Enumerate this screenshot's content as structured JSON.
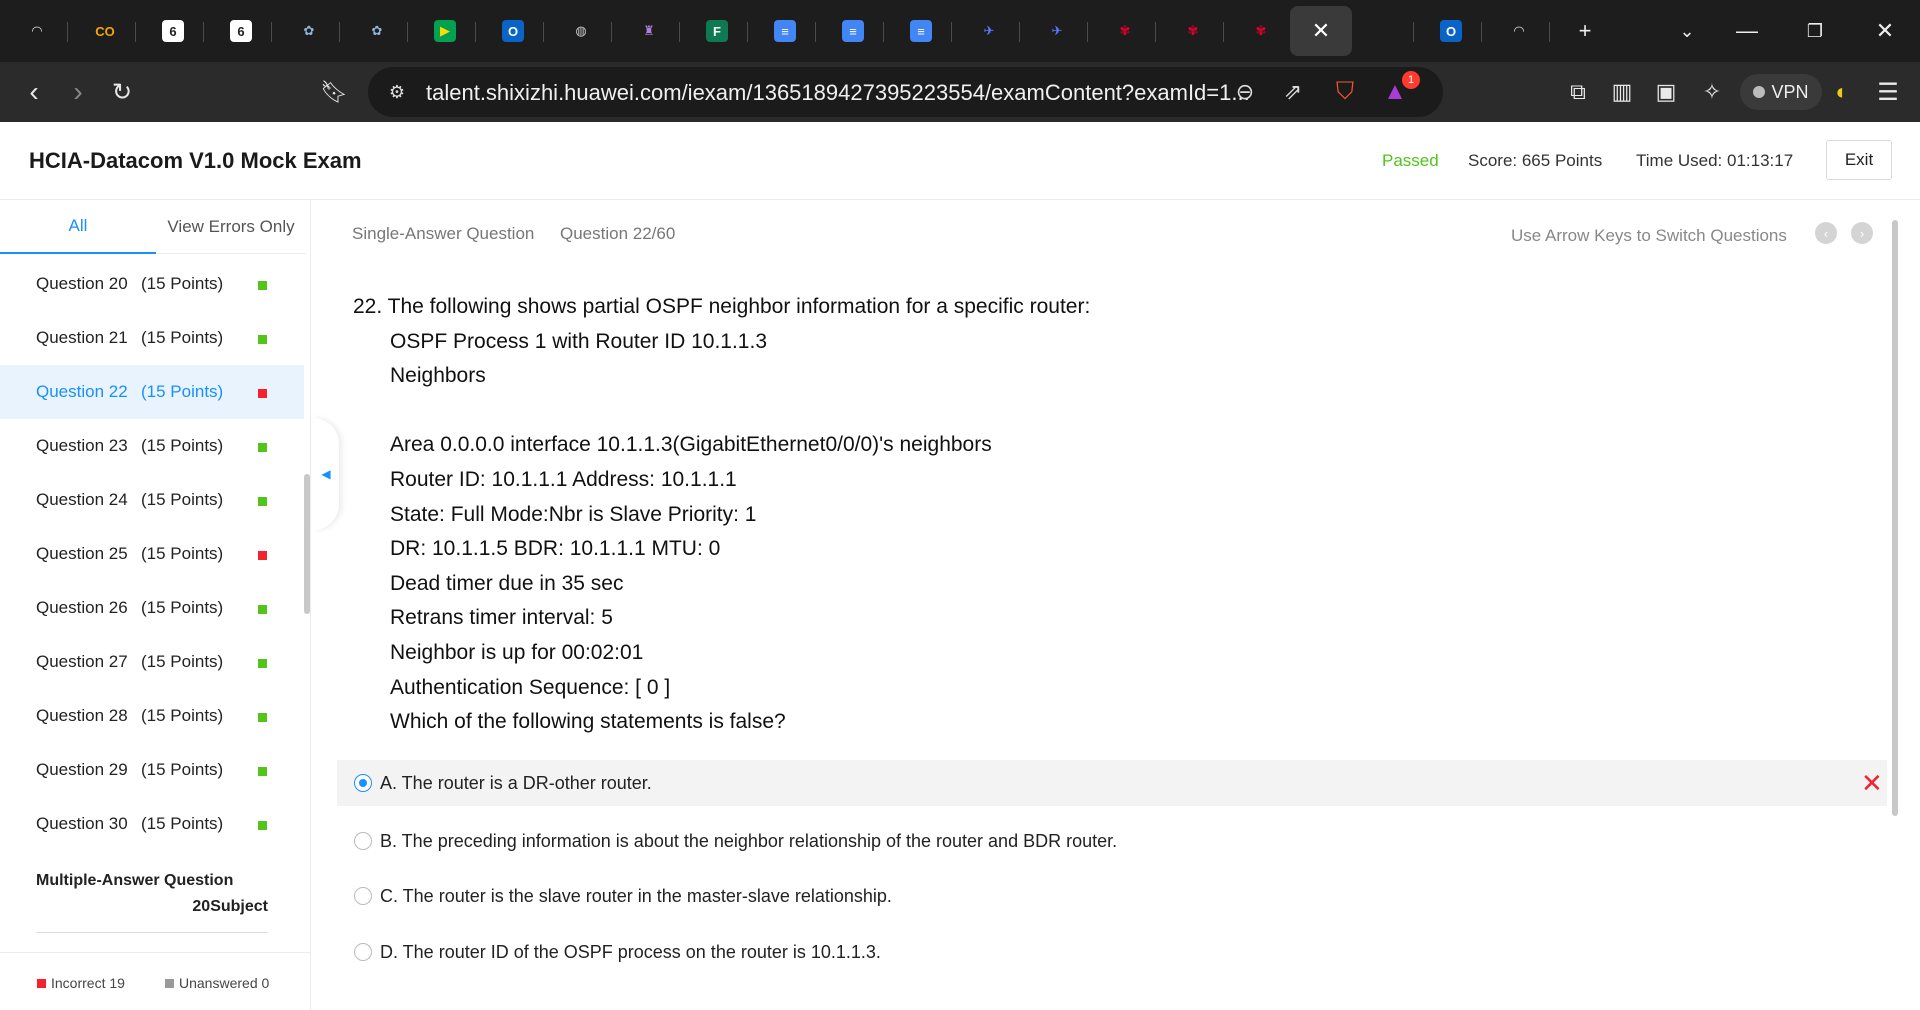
{
  "browser": {
    "tabs": [
      {
        "icon": "tab-icon-speedometer",
        "glyph": "◠",
        "bg": "#1d1d1d",
        "color": "#ddd"
      },
      {
        "icon": "tab-icon-co-logo",
        "glyph": "CO",
        "bg": "#1d1d1d",
        "color": "#f7a600"
      },
      {
        "icon": "tab-icon-six-logo",
        "glyph": "6",
        "bg": "#ffffff",
        "color": "#222"
      },
      {
        "icon": "tab-icon-six-logo",
        "glyph": "6",
        "bg": "#ffffff",
        "color": "#222"
      },
      {
        "icon": "tab-icon-emblem",
        "glyph": "✿",
        "bg": "#1d1d1d",
        "color": "#8fb3d9"
      },
      {
        "icon": "tab-icon-emblem",
        "glyph": "✿",
        "bg": "#1d1d1d",
        "color": "#8fb3d9"
      },
      {
        "icon": "tab-icon-meet",
        "glyph": "▶",
        "bg": "#00a150",
        "color": "#ffdd00"
      },
      {
        "icon": "tab-icon-outlook",
        "glyph": "O",
        "bg": "#0a64c8",
        "color": "#fff"
      },
      {
        "icon": "tab-icon-globe",
        "glyph": "◍",
        "bg": "#1d1d1d",
        "color": "#ccc"
      },
      {
        "icon": "tab-icon-building",
        "glyph": "♜",
        "bg": "#1d1d1d",
        "color": "#b07dd9"
      },
      {
        "icon": "tab-icon-forms",
        "glyph": "F",
        "bg": "#0e7a53",
        "color": "#fff"
      },
      {
        "icon": "tab-icon-docs",
        "glyph": "≡",
        "bg": "#4285f4",
        "color": "#fff"
      },
      {
        "icon": "tab-icon-docs",
        "glyph": "≡",
        "bg": "#4285f4",
        "color": "#fff"
      },
      {
        "icon": "tab-icon-docs",
        "glyph": "≡",
        "bg": "#4285f4",
        "color": "#fff"
      },
      {
        "icon": "tab-icon-bird",
        "glyph": "✈",
        "bg": "#1d1d1d",
        "color": "#5b7cff"
      },
      {
        "icon": "tab-icon-bird",
        "glyph": "✈",
        "bg": "#1d1d1d",
        "color": "#5b7cff"
      },
      {
        "icon": "tab-icon-huawei",
        "glyph": "✾",
        "bg": "#1d1d1d",
        "color": "#e4002b"
      },
      {
        "icon": "tab-icon-huawei",
        "glyph": "✾",
        "bg": "#1d1d1d",
        "color": "#e4002b"
      },
      {
        "icon": "tab-icon-huawei",
        "glyph": "✾",
        "bg": "#1d1d1d",
        "color": "#e4002b"
      }
    ],
    "active_tab_glyph": "✕",
    "url": "talent.shixizhi.huawei.com/iexam/1365189427395223554/examContent?examId=1...",
    "vpn_label": "VPN",
    "brave_badge": "1"
  },
  "header": {
    "title": "HCIA-Datacom V1.0 Mock Exam",
    "status": "Passed",
    "score": "Score:  665 Points",
    "time_used": "Time Used:  01:13:17",
    "exit_label": "Exit"
  },
  "sidebar": {
    "tab_all": "All",
    "tab_errors": "View Errors Only",
    "questions": [
      {
        "label": "Question 20",
        "points": "(15 Points)",
        "status": "correct"
      },
      {
        "label": "Question 21",
        "points": "(15 Points)",
        "status": "correct"
      },
      {
        "label": "Question 22",
        "points": "(15 Points)",
        "status": "incorrect"
      },
      {
        "label": "Question 23",
        "points": "(15 Points)",
        "status": "correct"
      },
      {
        "label": "Question 24",
        "points": "(15 Points)",
        "status": "correct"
      },
      {
        "label": "Question 25",
        "points": "(15 Points)",
        "status": "incorrect"
      },
      {
        "label": "Question 26",
        "points": "(15 Points)",
        "status": "correct"
      },
      {
        "label": "Question 27",
        "points": "(15 Points)",
        "status": "correct"
      },
      {
        "label": "Question 28",
        "points": "(15 Points)",
        "status": "correct"
      },
      {
        "label": "Question 29",
        "points": "(15 Points)",
        "status": "correct"
      },
      {
        "label": "Question 30",
        "points": "(15 Points)",
        "status": "correct"
      }
    ],
    "current_question": "Question 22",
    "multi_heading": "Multiple-Answer Question",
    "multi_sub": "20Subject",
    "legend_incorrect": "Incorrect 19",
    "legend_unanswered": "Unanswered 0"
  },
  "colors": {
    "accent": "#1890ff",
    "correct": "#52c41a",
    "incorrect": "#f5222d",
    "unanswered": "#999999"
  },
  "main": {
    "question_type": "Single-Answer Question",
    "question_number": "Question 22/60",
    "arrow_hint": "Use Arrow Keys to Switch Questions",
    "question_lines": [
      "22. The following shows partial OSPF neighbor information for a specific router:",
      "OSPF Process 1 with Router ID 10.1.1.3",
      "Neighbors",
      "",
      "Area 0.0.0.0 interface 10.1.1.3(GigabitEthernet0/0/0)'s neighbors",
      "Router ID: 10.1.1.1 Address: 10.1.1.1",
      "State: Full Mode:Nbr is Slave Priority: 1",
      "DR: 10.1.1.5 BDR: 10.1.1.1 MTU: 0",
      "Dead timer due in 35 sec",
      "Retrans timer interval: 5",
      "Neighbor is up for 00:02:01",
      "Authentication Sequence: [ 0 ]",
      "Which of the following statements is false?"
    ],
    "options": [
      {
        "text": "A. The router is a DR-other router.",
        "selected": true,
        "wrong": true
      },
      {
        "text": "B. The preceding information is about the neighbor relationship of the router and BDR router.",
        "selected": false,
        "wrong": false
      },
      {
        "text": "C. The router is the slave router in the master-slave relationship.",
        "selected": false,
        "wrong": false
      },
      {
        "text": "D. The router ID of the OSPF process on the router is 10.1.1.3.",
        "selected": false,
        "wrong": false
      }
    ],
    "wrong_mark": "✕"
  }
}
